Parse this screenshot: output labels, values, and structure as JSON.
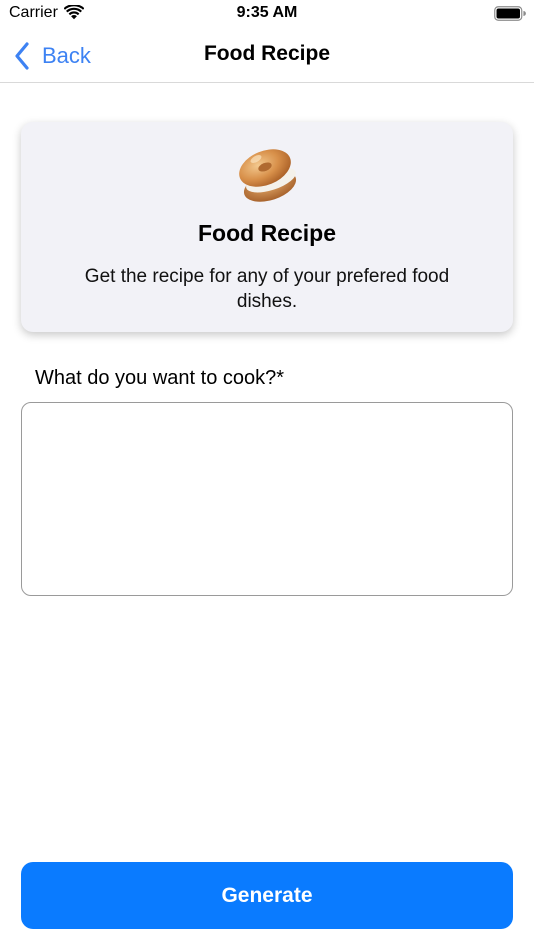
{
  "status_bar": {
    "carrier": "Carrier",
    "time": "9:35 AM",
    "wifi_icon": "wifi-icon",
    "battery_icon": "battery-icon"
  },
  "nav": {
    "back_label": "Back",
    "back_icon": "chevron-left-icon",
    "title": "Food Recipe"
  },
  "card": {
    "icon": "bagel-icon",
    "title": "Food Recipe",
    "subtitle": "Get the recipe for any of your prefered food dishes."
  },
  "prompt": {
    "label": "What do you want to cook?*",
    "value": "",
    "placeholder": ""
  },
  "actions": {
    "generate_label": "Generate"
  },
  "colors": {
    "accent": "#0a7bff",
    "back_link": "#3d82f3",
    "card_background": "#f2f2f7"
  }
}
